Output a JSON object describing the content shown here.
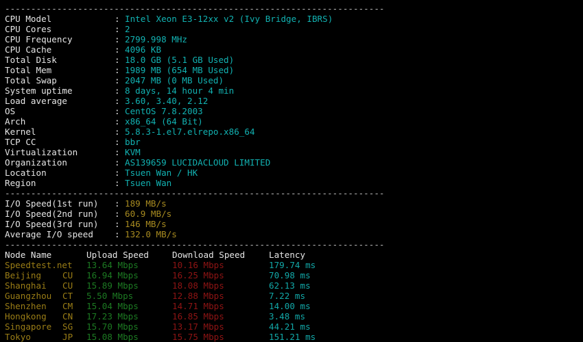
{
  "separator": "-------------------------------------------------------------------------",
  "sysinfo": {
    "rows": [
      {
        "label": "CPU Model",
        "value": "Intel Xeon E3-12xx v2 (Ivy Bridge, IBRS)"
      },
      {
        "label": "CPU Cores",
        "value": "2"
      },
      {
        "label": "CPU Frequency",
        "value": "2799.998 MHz"
      },
      {
        "label": "CPU Cache",
        "value": "4096 KB"
      },
      {
        "label": "Total Disk",
        "value": "18.0 GB (5.1 GB Used)"
      },
      {
        "label": "Total Mem",
        "value": "1989 MB (654 MB Used)"
      },
      {
        "label": "Total Swap",
        "value": "2047 MB (0 MB Used)"
      },
      {
        "label": "System uptime",
        "value": "8 days, 14 hour 4 min"
      },
      {
        "label": "Load average",
        "value": "3.60, 3.40, 2.12"
      },
      {
        "label": "OS",
        "value": "CentOS 7.8.2003"
      },
      {
        "label": "Arch",
        "value": "x86_64 (64 Bit)"
      },
      {
        "label": "Kernel",
        "value": "5.8.3-1.el7.elrepo.x86_64"
      },
      {
        "label": "TCP CC",
        "value": "bbr"
      },
      {
        "label": "Virtualization",
        "value": "KVM"
      },
      {
        "label": "Organization",
        "value": "AS139659 LUCIDACLOUD LIMITED"
      },
      {
        "label": "Location",
        "value": "Tsuen Wan / HK"
      },
      {
        "label": "Region",
        "value": "Tsuen Wan"
      }
    ]
  },
  "iospeed": {
    "rows": [
      {
        "label": "I/O Speed(1st run)",
        "value": "189 MB/s"
      },
      {
        "label": "I/O Speed(2nd run)",
        "value": "60.9 MB/s"
      },
      {
        "label": "I/O Speed(3rd run)",
        "value": "146 MB/s"
      },
      {
        "label": "Average I/O speed",
        "value": "132.0 MB/s"
      }
    ]
  },
  "speedtest": {
    "headers": {
      "node": "Node Name",
      "upload": "Upload Speed",
      "download": "Download Speed",
      "latency": "Latency"
    },
    "rows": [
      {
        "node": "Speedtest.net",
        "isp": "",
        "upload": "13.64 Mbps",
        "download": "10.16 Mbps",
        "latency": "179.74 ms"
      },
      {
        "node": "Beijing",
        "isp": "CU",
        "upload": "16.94 Mbps",
        "download": "16.25 Mbps",
        "latency": "70.98 ms"
      },
      {
        "node": "Shanghai",
        "isp": "CU",
        "upload": "15.89 Mbps",
        "download": "18.08 Mbps",
        "latency": "62.13 ms"
      },
      {
        "node": "Guangzhou",
        "isp": "CT",
        "upload": "5.50 Mbps",
        "download": "12.88 Mbps",
        "latency": "7.22 ms"
      },
      {
        "node": "Shenzhen",
        "isp": "CM",
        "upload": "15.04 Mbps",
        "download": "14.71 Mbps",
        "latency": "14.00 ms"
      },
      {
        "node": "Hongkong",
        "isp": "CN",
        "upload": "17.23 Mbps",
        "download": "16.85 Mbps",
        "latency": "3.48 ms"
      },
      {
        "node": "Singapore",
        "isp": "SG",
        "upload": "15.70 Mbps",
        "download": "13.17 Mbps",
        "latency": "44.21 ms"
      },
      {
        "node": "Tokyo",
        "isp": "JP",
        "upload": "15.08 Mbps",
        "download": "15.75 Mbps",
        "latency": "151.21 ms"
      }
    ]
  },
  "colors": {
    "background": "#000000",
    "label": "#e6e6e6",
    "value_cyan": "#12b2b2",
    "value_yellow": "#a88b20",
    "node": "#9a7d16",
    "upload": "#1c7a22",
    "download": "#8f1414",
    "latency": "#12a8a8"
  }
}
